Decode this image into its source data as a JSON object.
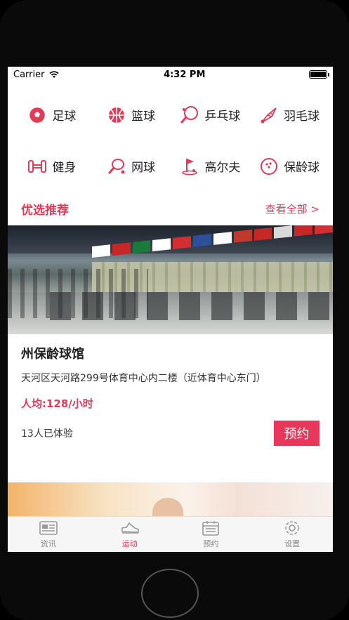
{
  "status": {
    "carrier": "Carrier",
    "time": "4:32 PM"
  },
  "categories": [
    {
      "label": "足球",
      "icon": "soccer-ball-icon"
    },
    {
      "label": "篮球",
      "icon": "basketball-icon"
    },
    {
      "label": "乒乓球",
      "icon": "ping-pong-paddle-icon"
    },
    {
      "label": "羽毛球",
      "icon": "shuttlecock-icon"
    },
    {
      "label": "健身",
      "icon": "dumbbell-icon"
    },
    {
      "label": "网球",
      "icon": "tennis-racket-icon"
    },
    {
      "label": "高尔夫",
      "icon": "golf-flag-icon"
    },
    {
      "label": "保龄球",
      "icon": "bowling-ball-icon"
    }
  ],
  "section": {
    "title": "优选推荐",
    "more": "查看全部 >"
  },
  "venue": {
    "name": "州保龄球馆",
    "address": "天河区天河路299号体育中心内二楼（近体育中心东门）",
    "price": "人均:128/小时",
    "count": "13人已体验",
    "book_label": "预约"
  },
  "tabs": [
    {
      "label": "资讯",
      "icon": "news-icon",
      "active": false
    },
    {
      "label": "运动",
      "icon": "sneaker-icon",
      "active": true
    },
    {
      "label": "预约",
      "icon": "calendar-icon",
      "active": false
    },
    {
      "label": "设置",
      "icon": "gear-icon",
      "active": false
    }
  ],
  "colors": {
    "accent": "#e53958",
    "button": "#e8375a"
  }
}
